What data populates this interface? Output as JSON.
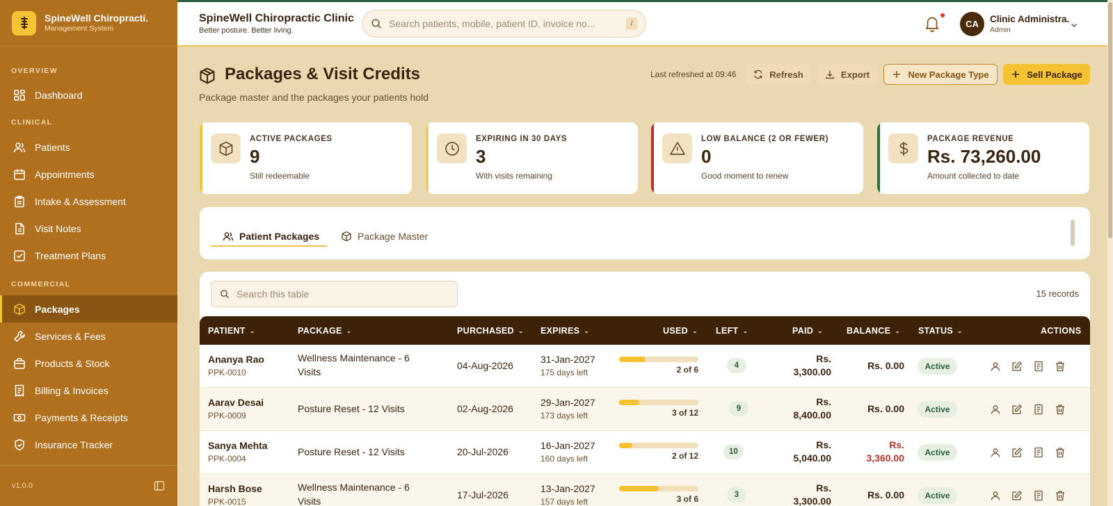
{
  "sidebar": {
    "brand_name": "SpineWell Chiropracti.",
    "brand_sub": "Management System",
    "sections": [
      "OVERVIEW",
      "CLINICAL",
      "COMMERCIAL"
    ],
    "items": [
      {
        "label": "Dashboard",
        "icon": "dashboard-icon"
      },
      {
        "label": "Patients",
        "icon": "users-icon"
      },
      {
        "label": "Appointments",
        "icon": "calendar-icon"
      },
      {
        "label": "Intake & Assessment",
        "icon": "clipboard-icon"
      },
      {
        "label": "Visit Notes",
        "icon": "document-icon"
      },
      {
        "label": "Treatment Plans",
        "icon": "checklist-icon"
      },
      {
        "label": "Packages",
        "icon": "box-icon"
      },
      {
        "label": "Services & Fees",
        "icon": "wrench-icon"
      },
      {
        "label": "Products & Stock",
        "icon": "bag-icon"
      },
      {
        "label": "Billing & Invoices",
        "icon": "receipt-icon"
      },
      {
        "label": "Payments & Receipts",
        "icon": "cash-icon"
      },
      {
        "label": "Insurance Tracker",
        "icon": "shield-icon"
      }
    ],
    "version": "v1.0.0"
  },
  "header": {
    "clinic_title": "SpineWell Chiropractic Clinic",
    "clinic_sub": "Better posture. Better living.",
    "search_placeholder": "Search patients, mobile, patient ID, invoice no...",
    "search_shortcut": "/",
    "user_initials": "CA",
    "user_name": "Clinic Administra.",
    "user_role": "Admin"
  },
  "page": {
    "title": "Packages & Visit Credits",
    "subtitle": "Package master and the packages your patients hold",
    "last_refreshed": "Last refreshed at 09:46",
    "buttons": {
      "refresh": "Refresh",
      "export": "Export",
      "new_type": "New Package Type",
      "sell": "Sell Package"
    }
  },
  "kpis": [
    {
      "label": "ACTIVE PACKAGES",
      "value": "9",
      "note": "Still redeemable",
      "accent": "#f4c232"
    },
    {
      "label": "EXPIRING IN 30 DAYS",
      "value": "3",
      "note": "With visits remaining",
      "accent": "#f0c868"
    },
    {
      "label": "LOW BALANCE (2 OR FEWER)",
      "value": "0",
      "note": "Good moment to renew",
      "accent": "#b8322a"
    },
    {
      "label": "PACKAGE REVENUE",
      "value": "Rs. 73,260.00",
      "note": "Amount collected to date",
      "accent": "#2b6e3c"
    }
  ],
  "tabs": {
    "patient_packages": "Patient Packages",
    "package_master": "Package Master"
  },
  "table": {
    "search_placeholder": "Search this table",
    "records": "15 records",
    "columns": {
      "patient": "PATIENT",
      "package": "PACKAGE",
      "purchased": "PURCHASED",
      "expires": "EXPIRES",
      "used": "USED",
      "left": "LEFT",
      "paid": "PAID",
      "balance": "BALANCE",
      "status": "STATUS",
      "actions": "ACTIONS"
    },
    "rows": [
      {
        "name": "Ananya Rao",
        "id": "PPK-0010",
        "package_l1": "Wellness Maintenance - 6",
        "package_l2": "Visits",
        "purchased": "04-Aug-2026",
        "expires": "31-Jan-2027",
        "days_left": "175 days left",
        "used": "2 of 6",
        "used_fraction": 0.333,
        "left": "4",
        "paid_l1": "Rs.",
        "paid_l2": "3,300.00",
        "balance_l1": "Rs. 0.00",
        "balance_l2": "",
        "status": "Active"
      },
      {
        "name": "Aarav Desai",
        "id": "PPK-0009",
        "package_l1": "Posture Reset - 12 Visits",
        "package_l2": "",
        "purchased": "02-Aug-2026",
        "expires": "29-Jan-2027",
        "days_left": "173 days left",
        "used": "3 of 12",
        "used_fraction": 0.25,
        "left": "9",
        "paid_l1": "Rs.",
        "paid_l2": "8,400.00",
        "balance_l1": "Rs. 0.00",
        "balance_l2": "",
        "status": "Active"
      },
      {
        "name": "Sanya Mehta",
        "id": "PPK-0004",
        "package_l1": "Posture Reset - 12 Visits",
        "package_l2": "",
        "purchased": "20-Jul-2026",
        "expires": "16-Jan-2027",
        "days_left": "160 days left",
        "used": "2 of 12",
        "used_fraction": 0.167,
        "left": "10",
        "paid_l1": "Rs.",
        "paid_l2": "5,040.00",
        "balance_l1": "Rs.",
        "balance_l2": "3,360.00",
        "status": "Active"
      },
      {
        "name": "Harsh Bose",
        "id": "PPK-0015",
        "package_l1": "Wellness Maintenance - 6",
        "package_l2": "Visits",
        "purchased": "17-Jul-2026",
        "expires": "13-Jan-2027",
        "days_left": "157 days left",
        "used": "3 of 6",
        "used_fraction": 0.5,
        "left": "3",
        "paid_l1": "Rs.",
        "paid_l2": "3,300.00",
        "balance_l1": "Rs. 0.00",
        "balance_l2": "",
        "status": "Active"
      }
    ]
  }
}
